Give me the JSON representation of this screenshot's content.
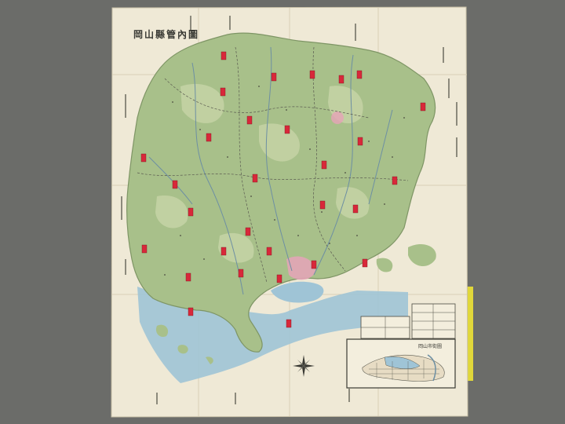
{
  "map": {
    "title": "岡山縣管內圖",
    "inset_title": "岡山市街圖",
    "colors": {
      "background": "#6b6c69",
      "paper": "#efe9d6",
      "land": "#a8c08a",
      "land_light": "#c6d3a6",
      "sea": "#9fc4d6",
      "markers": "#d8283a",
      "ink": "#3a3a34",
      "yellow_edge": "#e0d73a",
      "city_pink": "#e6a3b8"
    },
    "marker_count": 30
  }
}
